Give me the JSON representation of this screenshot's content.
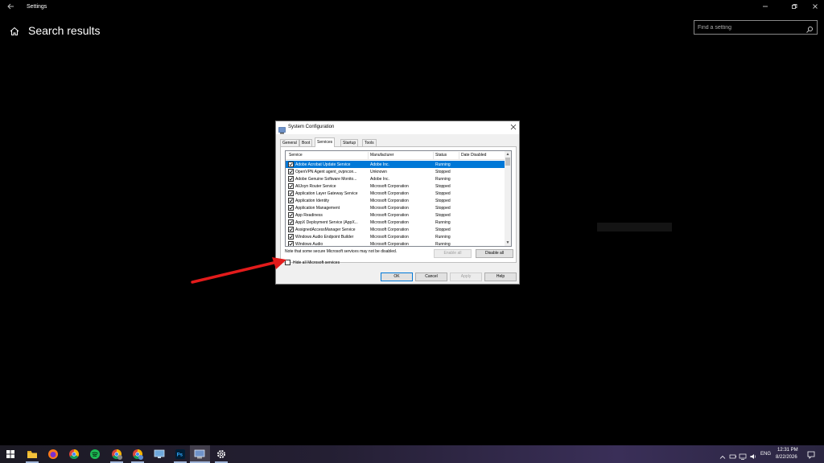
{
  "window": {
    "title": "Settings",
    "page_title": "Search results",
    "search_placeholder": "Find a setting"
  },
  "dialog": {
    "title": "System Configuration",
    "tabs": [
      "General",
      "Boot",
      "Services",
      "Startup",
      "Tools"
    ],
    "active_tab": "Services",
    "columns": [
      "Service",
      "Manufacturer",
      "Status",
      "Date Disabled"
    ],
    "services": [
      {
        "name": "Adobe Acrobat Update Service",
        "manufacturer": "Adobe Inc.",
        "status": "Running",
        "checked": true
      },
      {
        "name": "OpenVPN Agent agent_ovpncon...",
        "manufacturer": "Unknown",
        "status": "Stopped",
        "checked": true
      },
      {
        "name": "Adobe Genuine Software Monito...",
        "manufacturer": "Adobe Inc.",
        "status": "Running",
        "checked": true
      },
      {
        "name": "AllJoyn Router Service",
        "manufacturer": "Microsoft Corporation",
        "status": "Stopped",
        "checked": true
      },
      {
        "name": "Application Layer Gateway Service",
        "manufacturer": "Microsoft Corporation",
        "status": "Stopped",
        "checked": true
      },
      {
        "name": "Application Identity",
        "manufacturer": "Microsoft Corporation",
        "status": "Stopped",
        "checked": true
      },
      {
        "name": "Application Management",
        "manufacturer": "Microsoft Corporation",
        "status": "Stopped",
        "checked": true
      },
      {
        "name": "App Readiness",
        "manufacturer": "Microsoft Corporation",
        "status": "Stopped",
        "checked": true
      },
      {
        "name": "AppX Deployment Service (AppX...",
        "manufacturer": "Microsoft Corporation",
        "status": "Running",
        "checked": true
      },
      {
        "name": "AssignedAccessManager Service",
        "manufacturer": "Microsoft Corporation",
        "status": "Stopped",
        "checked": true
      },
      {
        "name": "Windows Audio Endpoint Builder",
        "manufacturer": "Microsoft Corporation",
        "status": "Running",
        "checked": true
      },
      {
        "name": "Windows Audio",
        "manufacturer": "Microsoft Corporation",
        "status": "Running",
        "checked": true
      }
    ],
    "note": "Note that some secure Microsoft services may not be disabled.",
    "enable_all": "Enable all",
    "disable_all": "Disable all",
    "hide_ms_label": "Hide all Microsoft services",
    "hide_ms_checked": false,
    "ok": "OK",
    "cancel": "Cancel",
    "apply": "Apply",
    "help": "Help"
  },
  "taskbar": {
    "icons": [
      "windows-start-icon",
      "file-explorer-icon",
      "firefox-icon",
      "chrome-icon",
      "spotify-icon",
      "chrome-icon",
      "chrome-icon",
      "remote-desktop-icon",
      "photoshop-icon",
      "system-configuration-icon",
      "settings-gear-icon"
    ],
    "language": "ENG",
    "time": "12:31 PM",
    "date": "8/22/2026"
  },
  "colors": {
    "accent": "#0078d7",
    "arrow": "#e31b1b"
  }
}
